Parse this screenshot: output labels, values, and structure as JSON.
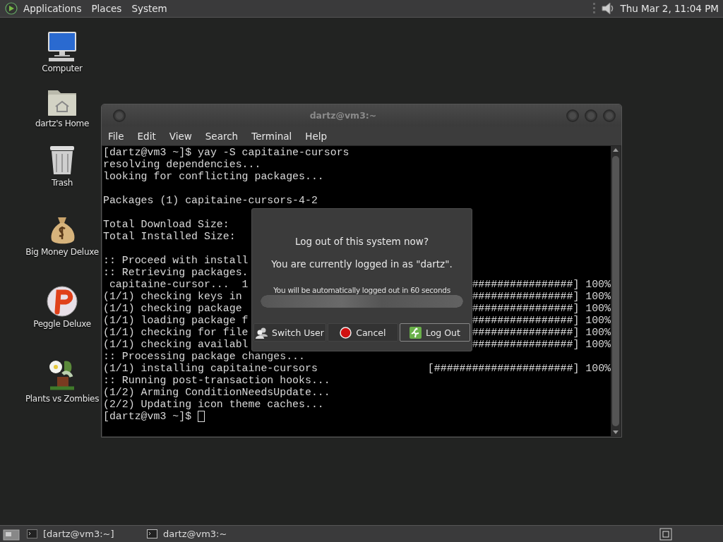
{
  "top_panel": {
    "menus": [
      "Applications",
      "Places",
      "System"
    ],
    "clock": "Thu Mar  2, 11:04 PM"
  },
  "desktop_icons": [
    {
      "kind": "computer",
      "label": "Computer"
    },
    {
      "kind": "home",
      "label": "dartz's Home"
    },
    {
      "kind": "trash",
      "label": "Trash"
    },
    {
      "kind": "money",
      "label": "Big Money Deluxe"
    },
    {
      "kind": "peggle",
      "label": "Peggle Deluxe"
    },
    {
      "kind": "plants",
      "label": "Plants vs Zombies"
    }
  ],
  "terminal": {
    "title": "dartz@vm3:~",
    "menu": [
      "File",
      "Edit",
      "View",
      "Search",
      "Terminal",
      "Help"
    ],
    "blocks": [
      {
        "lines": [
          {
            "text": "[dartz@vm3 ~]$ yay -S capitaine-cursors"
          },
          {
            "text": "resolving dependencies..."
          },
          {
            "text": "looking for conflicting packages..."
          }
        ]
      },
      {
        "lines": [
          {
            "text": "Packages (1) capitaine-cursors-4-2"
          }
        ]
      },
      {
        "lines": [
          {
            "text": "Total Download Size:"
          },
          {
            "text": "Total Installed Size:"
          }
        ]
      },
      {
        "lines": [
          {
            "text": ":: Proceed with install"
          },
          {
            "text": ":: Retrieving packages."
          },
          {
            "text": " capitaine-cursor...  1",
            "right": "################] 100%"
          },
          {
            "text": "(1/1) checking keys in",
            "right": "################] 100%"
          },
          {
            "text": "(1/1) checking package",
            "right": "################] 100%"
          },
          {
            "text": "(1/1) loading package f",
            "right": "################] 100%"
          },
          {
            "text": "(1/1) checking for file",
            "right": "################] 100%"
          },
          {
            "text": "(1/1) checking availabl",
            "right": "################] 100%"
          },
          {
            "text": ":: Processing package changes..."
          },
          {
            "text": "(1/1) installing capitaine-cursors",
            "right": "[######################] 100%"
          },
          {
            "text": ":: Running post-transaction hooks..."
          },
          {
            "text": "(1/2) Arming ConditionNeedsUpdate..."
          },
          {
            "text": "(2/2) Updating icon theme caches..."
          },
          {
            "text": "[dartz@vm3 ~]$ ",
            "cursor": true
          }
        ]
      }
    ]
  },
  "logout_dialog": {
    "title": "Log out of this system now?",
    "message": "You are currently logged in as \"dartz\".",
    "countdown": "You will be automatically logged out in 60 seconds",
    "progress": {
      "level": 1
    },
    "buttons": [
      {
        "kind": "switch",
        "label": "Switch User",
        "focused": false
      },
      {
        "kind": "cancel",
        "label": "Cancel",
        "focused": false
      },
      {
        "kind": "logout",
        "label": "Log Out",
        "focused": true
      }
    ]
  },
  "taskbar": {
    "tasks": [
      {
        "label": "[dartz@vm3:~]",
        "minimized": true
      },
      {
        "label": "dartz@vm3:~",
        "minimized": false
      }
    ]
  }
}
